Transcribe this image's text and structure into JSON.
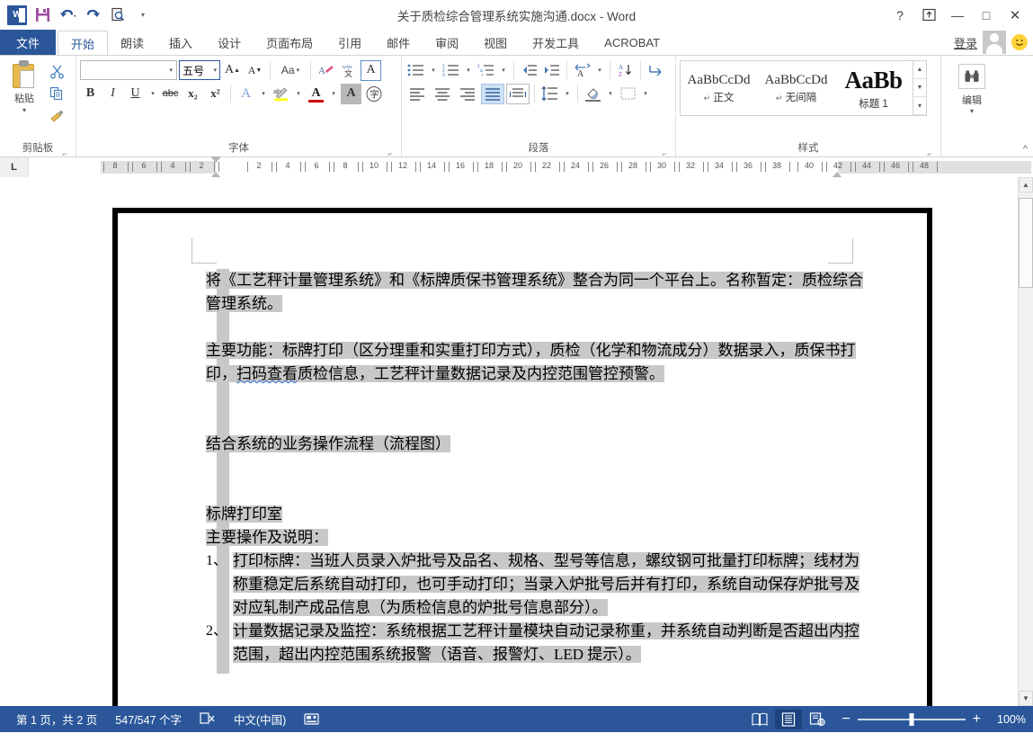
{
  "window": {
    "title": "关于质检综合管理系统实施沟通.docx - Word",
    "logo_text": "W",
    "help_icon": "?",
    "ribbon_display_icon": "ribbon-display-options-icon",
    "minimize_icon": "—",
    "maximize_icon": "□",
    "close_icon": "✕"
  },
  "quick_access": [
    {
      "name": "save",
      "icon": "save-icon"
    },
    {
      "name": "undo",
      "icon": "undo-icon"
    },
    {
      "name": "redo",
      "icon": "redo-icon"
    },
    {
      "name": "print-preview",
      "icon": "print-preview-icon"
    },
    {
      "name": "customize",
      "icon": "chevron-down-icon"
    }
  ],
  "tabs": {
    "file": "文件",
    "items": [
      {
        "label": "开始",
        "active": true
      },
      {
        "label": "朗读",
        "active": false
      },
      {
        "label": "插入",
        "active": false
      },
      {
        "label": "设计",
        "active": false
      },
      {
        "label": "页面布局",
        "active": false
      },
      {
        "label": "引用",
        "active": false
      },
      {
        "label": "邮件",
        "active": false
      },
      {
        "label": "审阅",
        "active": false
      },
      {
        "label": "视图",
        "active": false
      },
      {
        "label": "开发工具",
        "active": false
      },
      {
        "label": "ACROBAT",
        "active": false
      }
    ],
    "signin": "登录"
  },
  "ribbon": {
    "clipboard": {
      "label": "剪贴板",
      "paste_label": "粘贴",
      "cut_icon": "scissors-icon",
      "copy_icon": "copy-icon",
      "format_painter_icon": "format-painter-icon"
    },
    "font": {
      "label": "字体",
      "font_name_value": "",
      "font_name_placeholder": "",
      "font_size_value": "五号",
      "grow_font": "A",
      "shrink_font": "A",
      "change_case": "Aa",
      "clear_formatting_icon": "clear-formatting-icon",
      "phonetic_guide": "wén",
      "char_border": "A",
      "bold": "B",
      "italic": "I",
      "underline": "U",
      "strikethrough": "abc",
      "subscript": "x₂",
      "superscript": "x²",
      "text_effects": "A",
      "highlight": "ab",
      "font_color": "A",
      "shading_char": "A",
      "enclose_char": "字"
    },
    "paragraph": {
      "label": "段落",
      "bullets_icon": "bullets-icon",
      "numbering_icon": "numbering-icon",
      "multilevel_icon": "multilevel-list-icon",
      "decrease_indent_icon": "decrease-indent-icon",
      "increase_indent_icon": "increase-indent-icon",
      "sort_asian_icon": "asian-layout-icon",
      "sort_icon": "sort-icon",
      "show_marks_icon": "show-paragraph-marks-icon",
      "align_left_icon": "align-left-icon",
      "align_center_icon": "align-center-icon",
      "align_right_icon": "align-right-icon",
      "align_justify_icon": "align-justify-icon",
      "distribute_icon": "distribute-icon",
      "line_spacing_icon": "line-spacing-icon",
      "shading_icon": "shading-icon",
      "borders_icon": "borders-icon"
    },
    "styles": {
      "label": "样式",
      "items": [
        {
          "preview": "AaBbCcDd",
          "name": "正文",
          "mark": "↵",
          "size": "normal"
        },
        {
          "preview": "AaBbCcDd",
          "name": "无间隔",
          "mark": "↵",
          "size": "normal"
        },
        {
          "preview": "AaBb",
          "name": "标题 1",
          "mark": "",
          "size": "big"
        }
      ],
      "scroll_up": "▲",
      "scroll_down": "▼",
      "more": "▾"
    },
    "editing": {
      "label": "编辑",
      "icon": "find-binoculars-icon",
      "caret": "▾"
    },
    "collapse_icon": "^"
  },
  "ruler": {
    "tabstop_marker": "L",
    "left_ticks": [
      "8",
      "6",
      "4",
      "2"
    ],
    "right_ticks": [
      "2",
      "4",
      "6",
      "8",
      "10",
      "12",
      "14",
      "16",
      "18",
      "20",
      "22",
      "24",
      "26",
      "28",
      "30",
      "32",
      "34",
      "36",
      "38",
      "40",
      "42",
      "44",
      "46",
      "48"
    ]
  },
  "document": {
    "paragraphs": [
      {
        "type": "text",
        "runs": [
          {
            "text": "将《工艺秤计量管理系统》和《标牌质保书管理系统》整合为同一个平台上。名称暂定：质检综合管理系统。",
            "wavy": false
          }
        ]
      },
      {
        "type": "blank"
      },
      {
        "type": "text",
        "runs": [
          {
            "text": "主要功能：标牌打印（区分理重和实重打印方式），质检（化学和物流成分）数据录入，质保书打印，",
            "wavy": false
          },
          {
            "text": "扫码查看",
            "wavy": true
          },
          {
            "text": "质检信息，工艺秤计量数据记录及内控范围管控预警。",
            "wavy": false
          }
        ]
      },
      {
        "type": "blank"
      },
      {
        "type": "blank"
      },
      {
        "type": "text",
        "runs": [
          {
            "text": "结合系统的业务操作流程（流程图）",
            "wavy": false
          }
        ]
      },
      {
        "type": "blank"
      },
      {
        "type": "blank"
      },
      {
        "type": "text",
        "runs": [
          {
            "text": "标牌打印室",
            "wavy": false
          }
        ]
      },
      {
        "type": "text",
        "runs": [
          {
            "text": "主要操作及说明：",
            "wavy": false
          }
        ]
      },
      {
        "type": "list",
        "num": "1、",
        "runs": [
          {
            "text": "打印标牌：当班人员录入炉批号及品名、规格、型号等信息，螺纹钢可批量打印标牌；线材为称重稳定后系统自动打印，也可手动打印；当录入炉批号后并有打印，系统自动保存炉批号及对应轧制产成品信息（为质检信息的炉批号信息部分）。",
            "wavy": false
          }
        ]
      },
      {
        "type": "list",
        "num": "2、",
        "runs": [
          {
            "text": "计量数据记录及监控：系统根据工艺秤计量模块自动记录称重，并系统自动判断是否超出内控范围，超出内控范围系统报警（语音、报警灯、LED 提示）。",
            "wavy": false
          }
        ]
      }
    ]
  },
  "statusbar": {
    "page_info": "第 1 页，共 2 页",
    "word_count": "547/547 个字",
    "proofing_icon": "proofing-errors-icon",
    "language": "中文(中国)",
    "macro_icon": "record-macro-icon",
    "view_read_icon": "read-mode-icon",
    "view_print_icon": "print-layout-icon",
    "view_web_icon": "web-layout-icon",
    "zoom_out": "−",
    "zoom_in": "+",
    "zoom_level": "100%"
  },
  "colors": {
    "accent": "#2b579a",
    "selection": "#c8c8c8",
    "wavy_underline": "#3a6fd8",
    "highlight_yellow": "#ffff00",
    "font_color_red": "#cc0000"
  }
}
